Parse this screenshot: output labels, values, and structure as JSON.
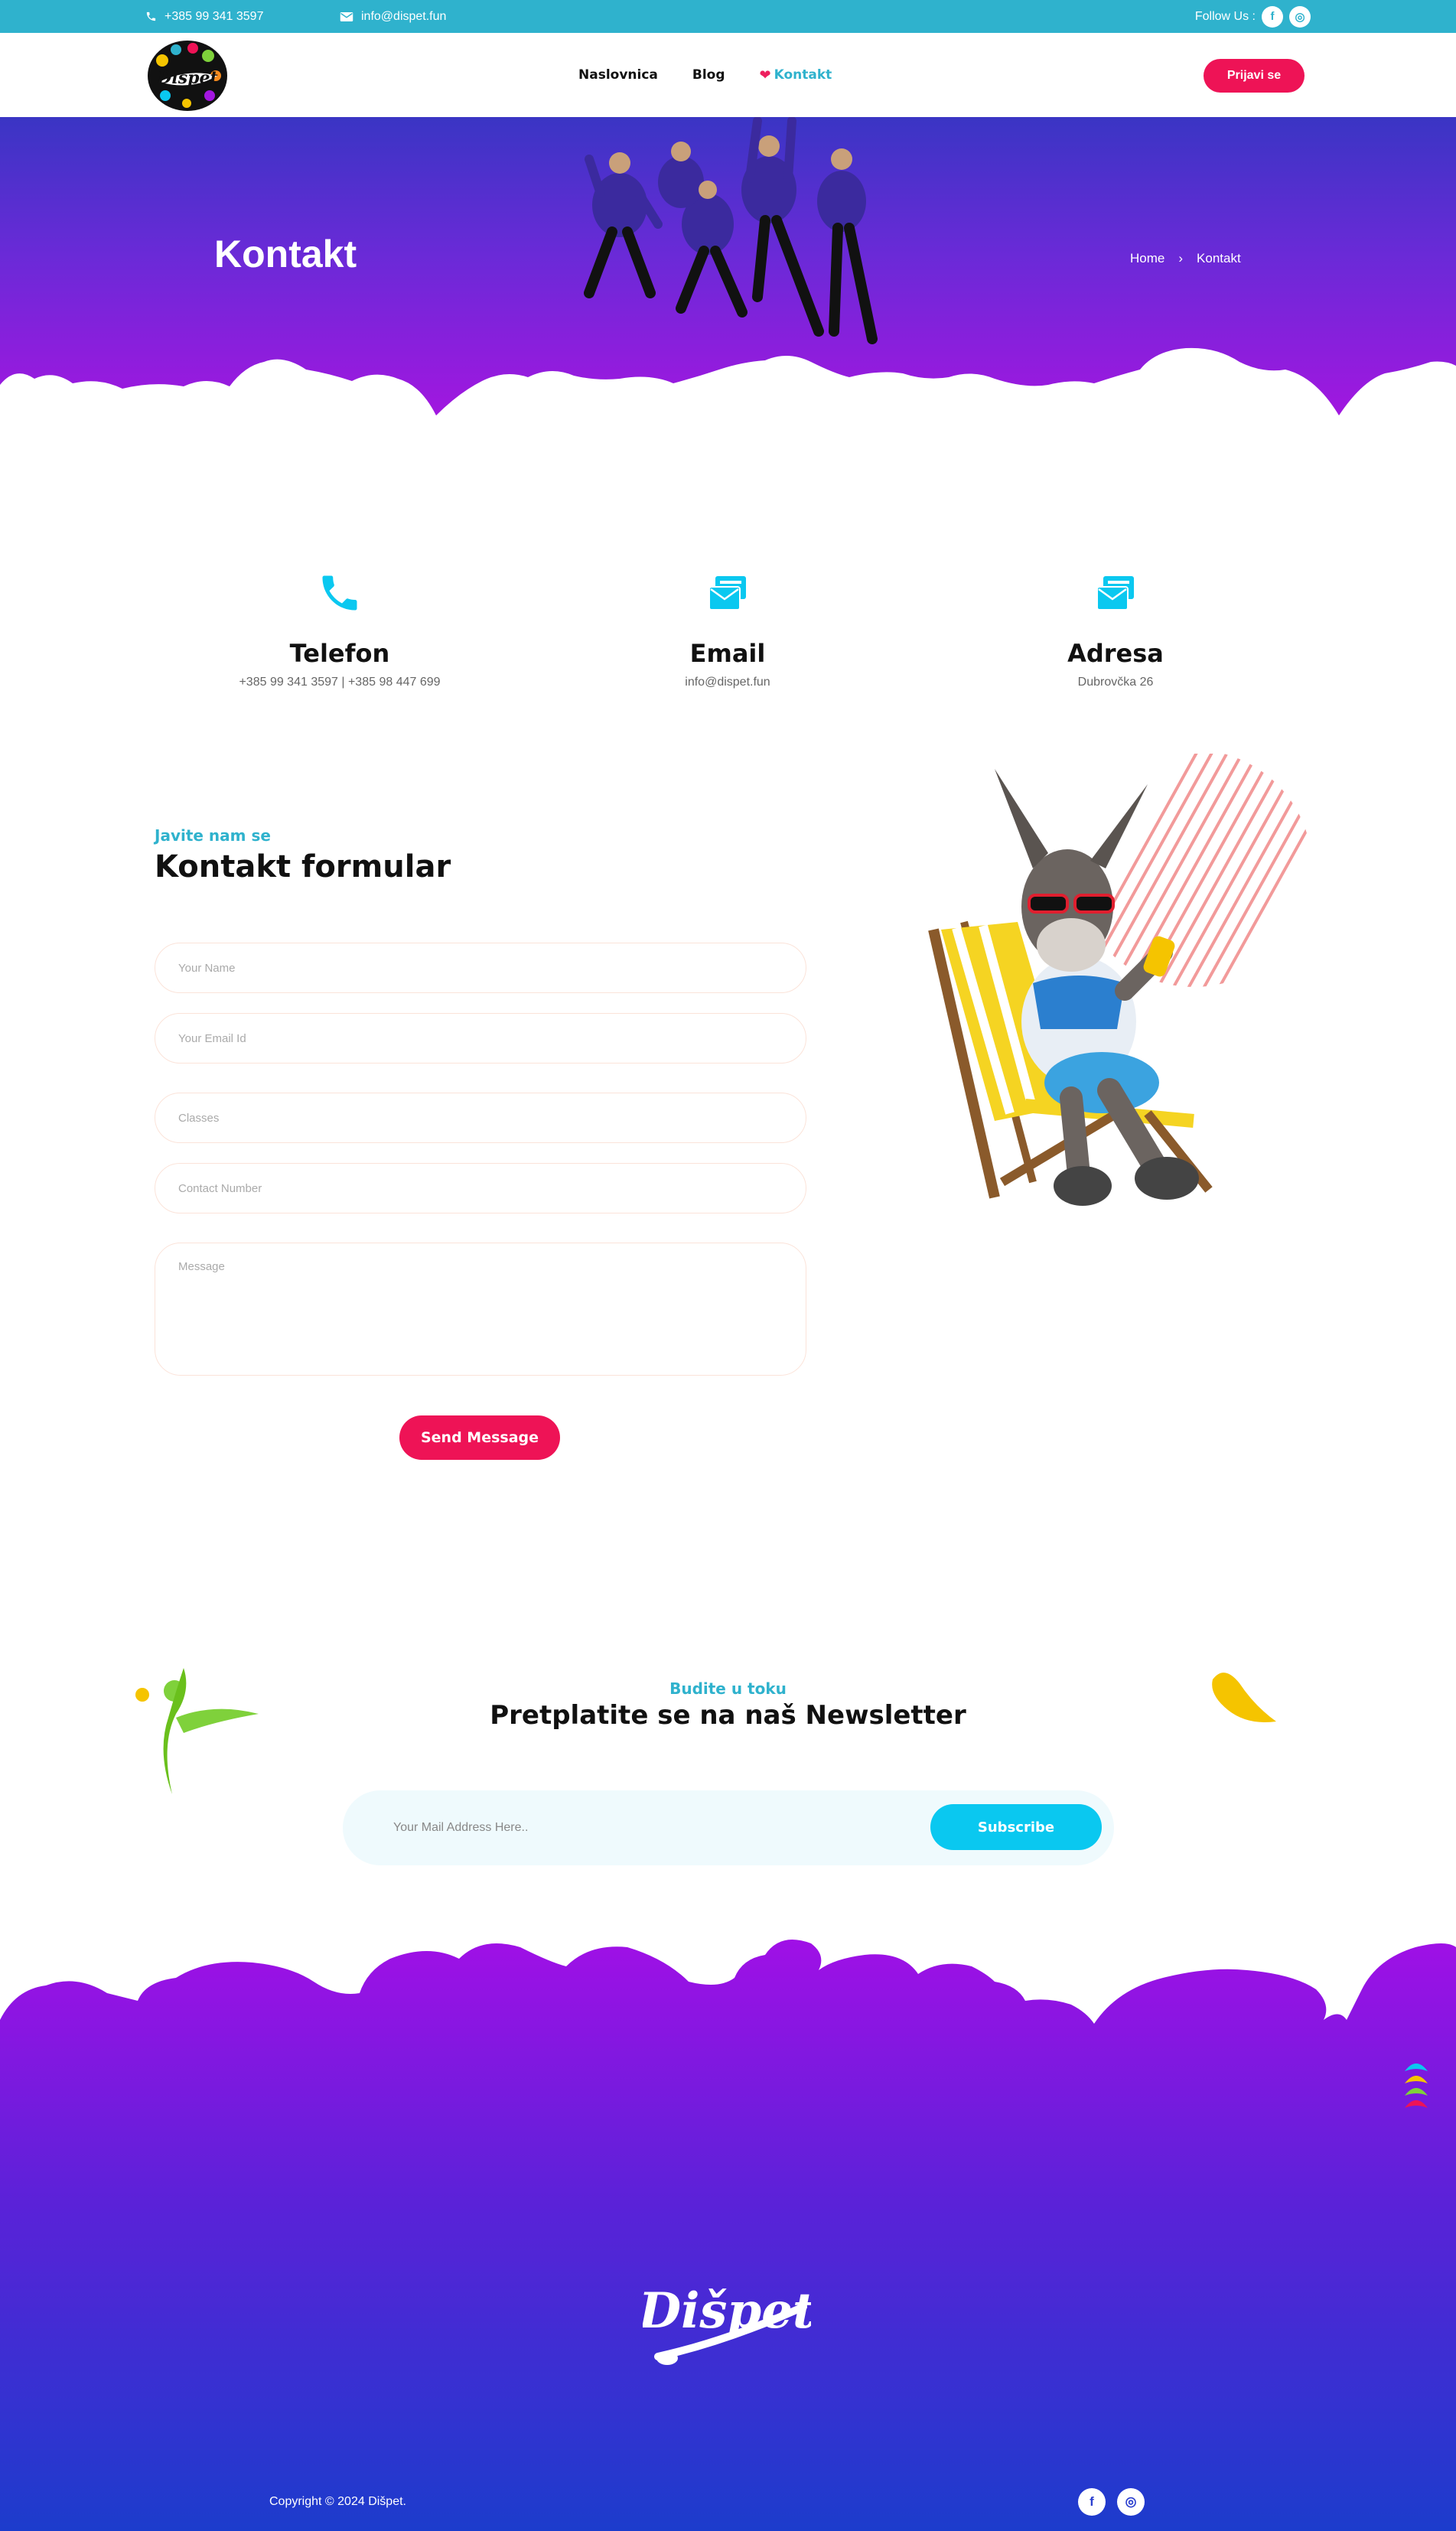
{
  "topbar": {
    "phone": "+385 99 341 3597",
    "email": "info@dispet.fun",
    "follow_label": "Follow Us :",
    "facebook_icon": "f",
    "instagram_icon": "◎"
  },
  "header": {
    "logo_text": "Dišpet",
    "nav": [
      {
        "label": "Naslovnica"
      },
      {
        "label": "Blog"
      },
      {
        "label": "Kontakt",
        "active": true
      }
    ],
    "signup_label": "Prijavi se"
  },
  "hero": {
    "title": "Kontakt",
    "breadcrumb": {
      "home": "Home",
      "separator": "›",
      "current": "Kontakt"
    }
  },
  "contact_info": [
    {
      "icon": "phone-icon",
      "title": "Telefon",
      "text": "+385 99 341 3597 | +385 98 447 699"
    },
    {
      "icon": "mail-icon",
      "title": "Email",
      "text": "info@dispet.fun"
    },
    {
      "icon": "mail-icon",
      "title": "Adresa",
      "text": "Dubrovčka 26"
    }
  ],
  "form": {
    "kicker": "Javite nam se",
    "title": "Kontakt formular",
    "name_placeholder": "Your Name",
    "email_placeholder": "Your Email Id",
    "classes_placeholder": "Classes",
    "phone_placeholder": "Contact Number",
    "message_placeholder": "Message",
    "submit_label": "Send Message"
  },
  "newsletter": {
    "kicker": "Budite u toku",
    "title": "Pretplatite se na naš Newsletter",
    "input_placeholder": "Your Mail Address Here..",
    "subscribe_label": "Subscribe"
  },
  "footer": {
    "logo_text": "Dišpet",
    "copyright": "Copyright © 2024 Dišpet.",
    "facebook_icon": "f",
    "instagram_icon": "◎"
  },
  "colors": {
    "topbar": "#2fb2cd",
    "accent_pink": "#ee1356",
    "accent_cyan": "#0ac8f0",
    "hero_top": "#3a35c4",
    "hero_bottom": "#a416e0",
    "footer_top": "#a010e6",
    "footer_bottom": "#1c3ccc"
  }
}
